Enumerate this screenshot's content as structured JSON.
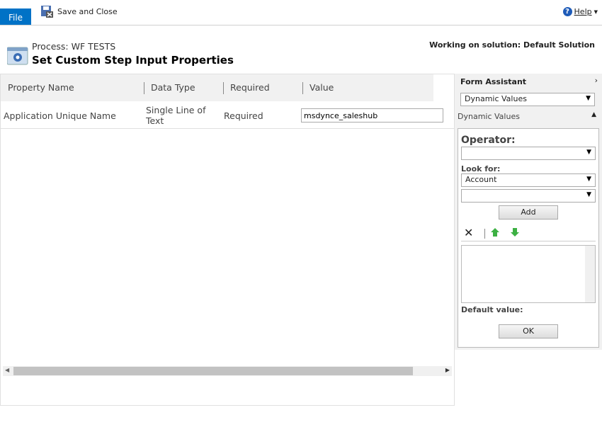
{
  "toolbar": {
    "file": "File",
    "save_close": "Save and Close",
    "help": "Help"
  },
  "header": {
    "process": "Process: WF TESTS",
    "title": "Set Custom Step Input Properties",
    "solution": "Working on solution: Default Solution"
  },
  "grid": {
    "columns": [
      "Property Name",
      "Data Type",
      "Required",
      "Value"
    ],
    "rows": [
      {
        "name": "Application Unique Name",
        "type": "Single Line of Text",
        "required": "Required",
        "value": "msdynce_saleshub"
      }
    ]
  },
  "assistant": {
    "title": "Form Assistant",
    "dropdown": "Dynamic Values",
    "section": "Dynamic Values",
    "operator_label": "Operator:",
    "operator_value": "",
    "lookfor_label": "Look for:",
    "lookfor_value": "Account",
    "lookfor_field": "",
    "add": "Add",
    "default_label": "Default value:",
    "ok": "OK"
  }
}
